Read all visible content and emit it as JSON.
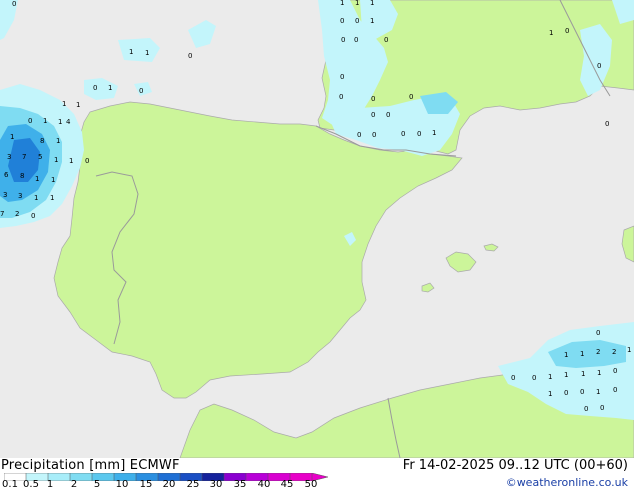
{
  "map": {
    "colors": {
      "sea": "#ebebeb",
      "land": "#ccf59a",
      "border": "#9a9a9a",
      "coast": "#aaaaaa",
      "rain_light": "#c3f5fb",
      "rain_mid": "#7fdcf2",
      "rain_heavy": "#3fb0ea",
      "rain_core": "#2080d8",
      "label": "#000000"
    },
    "precip_labels": [
      "0",
      "1",
      "1",
      "1",
      "0",
      "0",
      "1",
      "0",
      "0",
      "1",
      "0",
      "0",
      "1",
      "1",
      "0",
      "0",
      "0",
      "0",
      "1",
      "0",
      "0",
      "0",
      "0",
      "0",
      "0",
      "1",
      "1",
      "0",
      "0",
      "1",
      "1",
      "4",
      "8",
      "1",
      "1",
      "7",
      "3",
      "5",
      "1",
      "1",
      "0",
      "6",
      "8",
      "1",
      "1",
      "3",
      "3",
      "1",
      "1",
      "7",
      "2",
      "0",
      "0",
      "1",
      "1",
      "2",
      "2",
      "1",
      "0",
      "0",
      "1",
      "1",
      "1",
      "1",
      "0",
      "1",
      "0",
      "0",
      "1",
      "0",
      "0"
    ]
  },
  "footer": {
    "title_left": "Precipitation [mm]  ECMWF",
    "title_right": "Fr 14-02-2025 09..12 UTC (00+60)",
    "credit": "©weatheronline.co.uk",
    "legend": {
      "ticks": [
        "0.1",
        "0.5",
        "1",
        "2",
        "5",
        "10",
        "15",
        "20",
        "25",
        "30",
        "35",
        "40",
        "45",
        "50"
      ],
      "colors": [
        "#ffffff",
        "#c3f5fb",
        "#a8edf9",
        "#7fdcf2",
        "#5cc8ee",
        "#3fb0ea",
        "#2b8fe0",
        "#1f6fd4",
        "#1a4fc4",
        "#15229c",
        "#8a00d0",
        "#b800d8",
        "#d800d0",
        "#e800c8"
      ]
    }
  }
}
